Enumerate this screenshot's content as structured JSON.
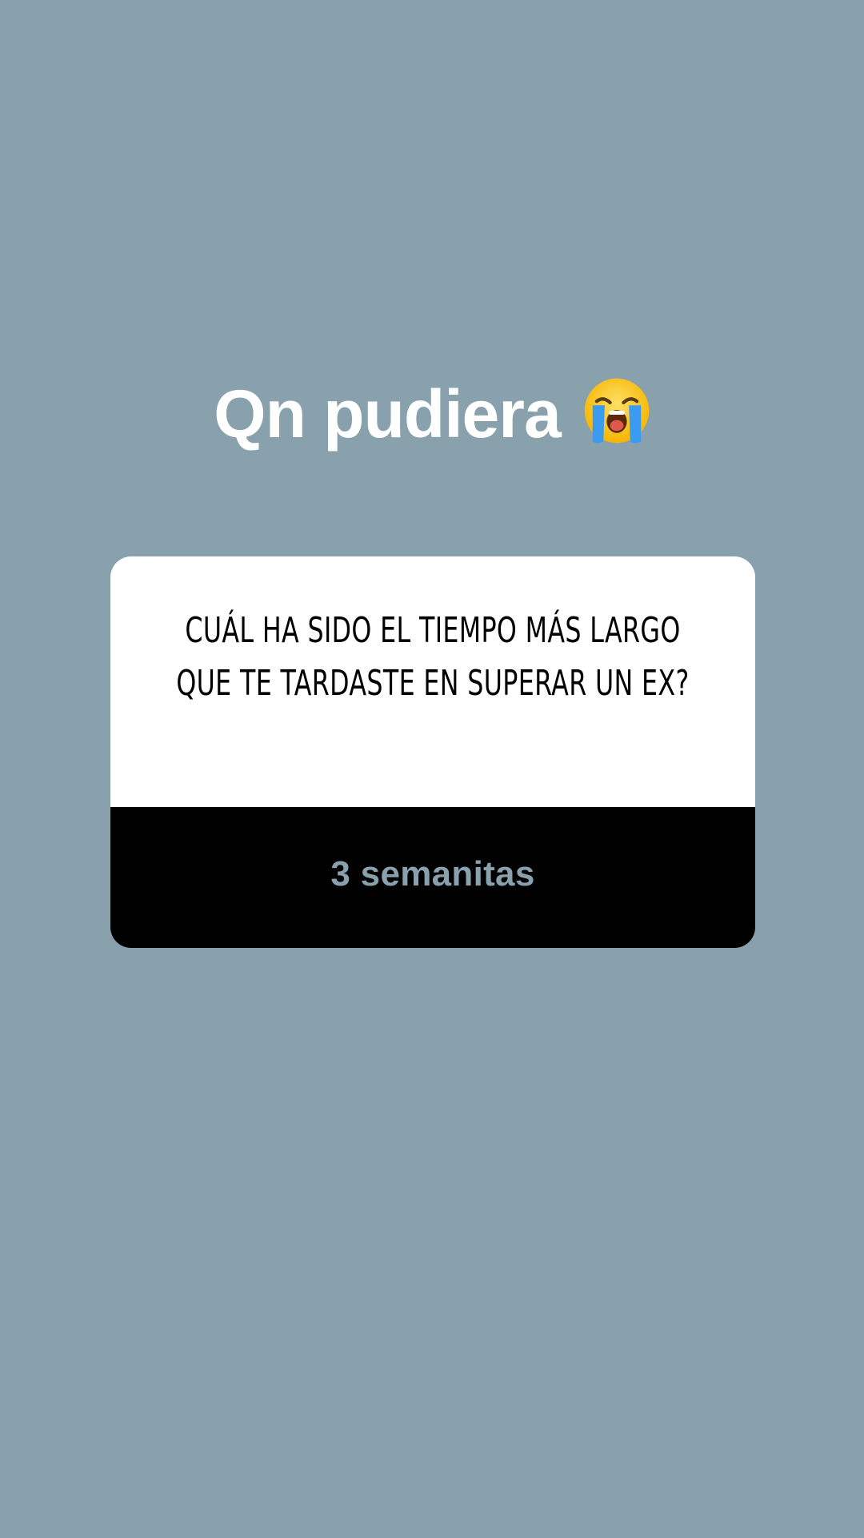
{
  "story": {
    "background_color": "#89a1ad",
    "caption": {
      "text": "Qn pudiera",
      "emoji": "loudly-crying-face-icon"
    },
    "question_card": {
      "question": "CUÁL HA SIDO EL TIEMPO MÁS LARGO QUE TE TARDASTE EN SUPERAR UN EX?",
      "answer": "3 semanitas",
      "answer_color": "#89a1ad"
    }
  }
}
